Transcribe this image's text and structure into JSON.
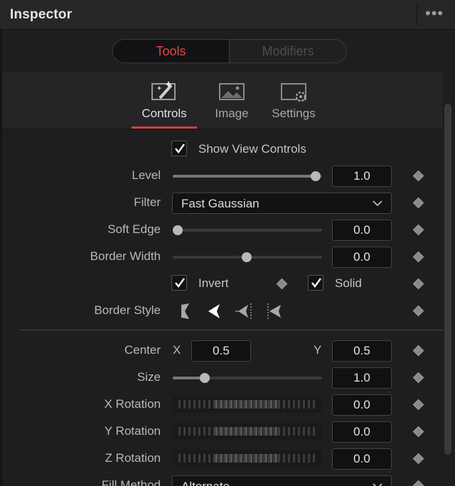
{
  "header": {
    "title": "Inspector",
    "menu_icon": "more-dots-icon"
  },
  "switch": {
    "tools_label": "Tools",
    "modifiers_label": "Modifiers",
    "active": "Tools"
  },
  "tabs": [
    {
      "label": "Controls",
      "icon": "controls-wand-icon",
      "active": true
    },
    {
      "label": "Image",
      "icon": "image-icon",
      "active": false
    },
    {
      "label": "Settings",
      "icon": "settings-icon",
      "active": false
    }
  ],
  "colors": {
    "accent": "#d24040",
    "active_tab_text": "#e44444",
    "panel_bg": "#1e1e20"
  },
  "controls": {
    "show_view_controls": {
      "label": "Show View Controls",
      "checked": true
    },
    "level": {
      "label": "Level",
      "value": "1.0",
      "slider_fraction": 1.0
    },
    "filter": {
      "label": "Filter",
      "value": "Fast Gaussian"
    },
    "soft_edge": {
      "label": "Soft Edge",
      "value": "0.0",
      "slider_fraction": 0.0
    },
    "border_width": {
      "label": "Border Width",
      "value": "0.0",
      "slider_fraction": 0.5
    },
    "invert": {
      "label": "Invert",
      "checked": true
    },
    "solid": {
      "label": "Solid",
      "checked": true
    },
    "border_style": {
      "label": "Border Style",
      "options": [
        "border-style-1-icon",
        "border-style-2-icon",
        "border-style-3-icon",
        "border-style-4-icon"
      ],
      "selected_index": 1
    },
    "center": {
      "label": "Center",
      "x_label": "X",
      "x_value": "0.5",
      "y_label": "Y",
      "y_value": "0.5"
    },
    "size": {
      "label": "Size",
      "value": "1.0",
      "slider_fraction": 0.2
    },
    "x_rotation": {
      "label": "X Rotation",
      "value": "0.0"
    },
    "y_rotation": {
      "label": "Y Rotation",
      "value": "0.0"
    },
    "z_rotation": {
      "label": "Z Rotation",
      "value": "0.0"
    },
    "fill_method": {
      "label": "Fill Method",
      "value": "Alternate"
    }
  }
}
